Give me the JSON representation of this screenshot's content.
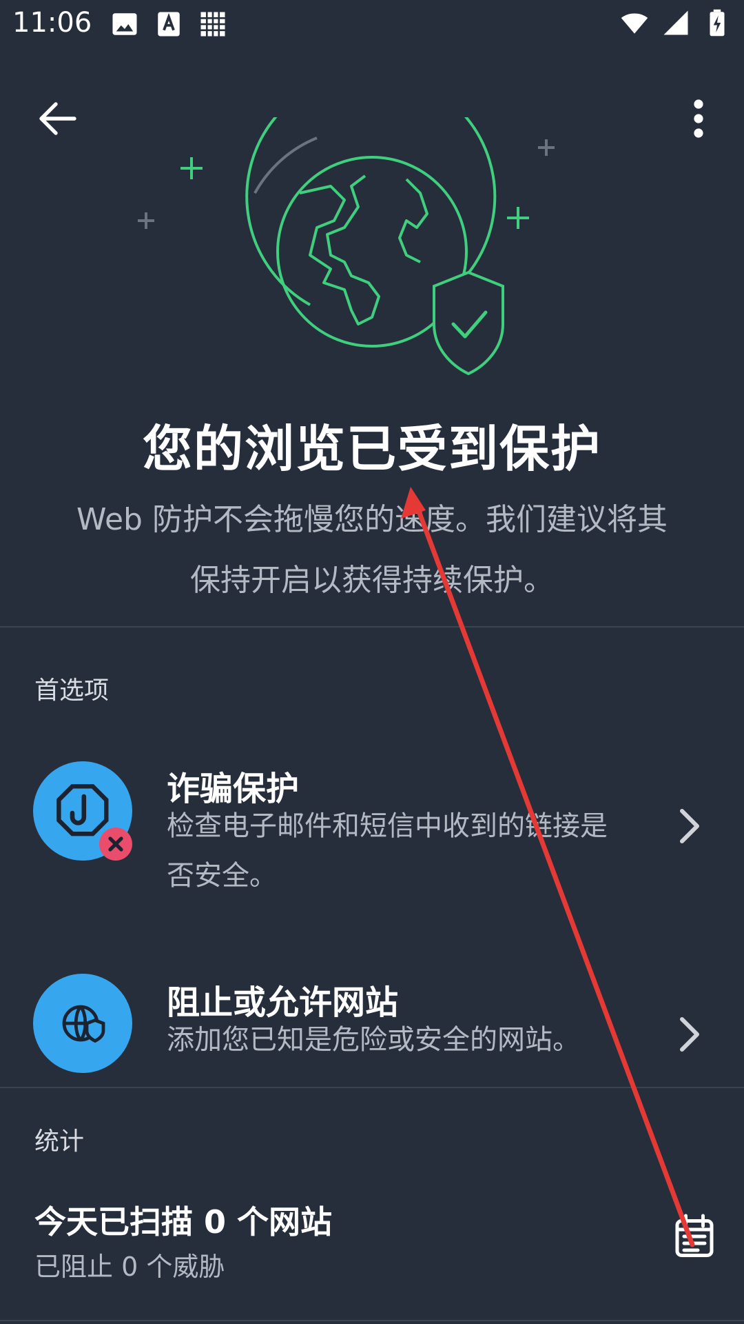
{
  "status_bar": {
    "time": "11:06",
    "left_icons": [
      "image-icon",
      "text-a-icon",
      "pattern-icon"
    ],
    "right_icons": [
      "wifi-icon",
      "signal-icon",
      "battery-charging-icon"
    ]
  },
  "toolbar": {
    "back_icon": "arrow-left-icon",
    "menu_icon": "more-vertical-icon"
  },
  "hero": {
    "illustration": "globe-shield-check-icon",
    "title": "您的浏览已受到保护",
    "description_line1": "Web 防护不会拖慢您的速度。我们建议将其",
    "description_line2": "保持开启以获得持续保护。"
  },
  "preferences": {
    "section_label": "首选项",
    "items": [
      {
        "icon": "phishing-hook-icon",
        "badge_icon": "close-icon",
        "title": "诈骗保护",
        "subtitle_line1": "检查电子邮件和短信中收到的链接是",
        "subtitle_line2": "否安全。"
      },
      {
        "icon": "globe-shield-icon",
        "title": "阻止或允许网站",
        "subtitle_line1": "添加您已知是危险或安全的网站。"
      }
    ]
  },
  "stats": {
    "section_label": "统计",
    "title": "今天已扫描 0 个网站",
    "subtitle": "已阻止 0 个威胁",
    "calendar_icon": "calendar-icon"
  },
  "colors": {
    "background": "#272e3b",
    "accent_green": "#3fcf7e",
    "icon_blue": "#36a7ee",
    "badge_red": "#ea4c6b",
    "annotation_red": "#e53935"
  }
}
